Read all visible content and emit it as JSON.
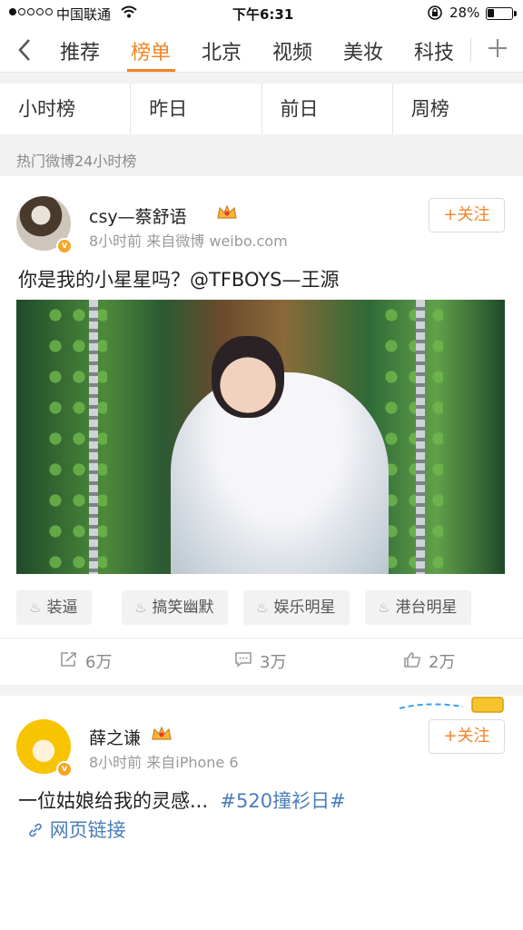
{
  "status_bar": {
    "carrier": "中国联通",
    "time": "下午6:31",
    "battery_text": "28%",
    "battery_level": 0.28,
    "signal_bars": 1
  },
  "nav": {
    "back_icon": "chevron-left-icon",
    "tabs": [
      {
        "label": "推荐",
        "active": false
      },
      {
        "label": "榜单",
        "active": true
      },
      {
        "label": "北京",
        "active": false
      },
      {
        "label": "视频",
        "active": false
      },
      {
        "label": "美妆",
        "active": false
      },
      {
        "label": "科技",
        "active": false
      }
    ],
    "add_icon": "plus-icon",
    "accent_color": "#f28427"
  },
  "subtabs": [
    "小时榜",
    "昨日",
    "前日",
    "周榜"
  ],
  "section_title": "热门微博24小时榜",
  "posts": [
    {
      "username": "csy—蔡舒语",
      "meta": "8小时前  来自微博 weibo.com",
      "follow_label": "+关注",
      "text": "你是我的小星星吗？@TFBOYS—王源",
      "tags": [
        "装逼",
        "搞笑幽默",
        "娱乐明星",
        "港台明星"
      ],
      "actions": {
        "repost": "6万",
        "comment": "3万",
        "like": "2万"
      }
    },
    {
      "username": "薛之谦",
      "meta": "8小时前  来自iPhone 6",
      "follow_label": "+关注",
      "text": "一位姑娘给我的灵感...",
      "topic": "#520撞衫日#",
      "link_label": "网页链接"
    }
  ],
  "colors": {
    "link": "#4a7db8",
    "badge": "#f6a623"
  }
}
